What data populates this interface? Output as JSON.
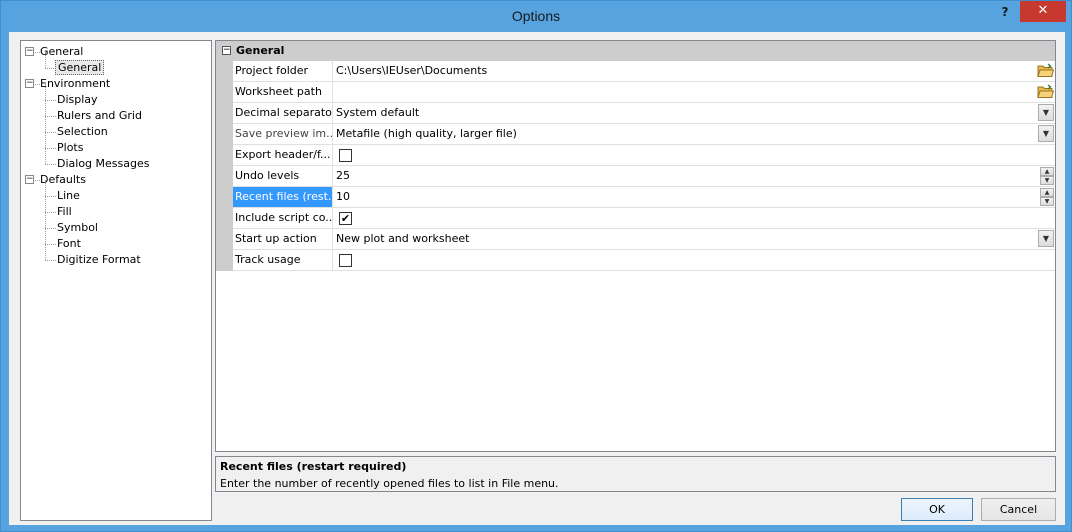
{
  "window": {
    "title": "Options",
    "help_label": "?",
    "close_label": "✕"
  },
  "tree": {
    "nodes": [
      {
        "label": "General",
        "level": 0,
        "expander": "−"
      },
      {
        "label": "General",
        "level": 1,
        "selected": true
      },
      {
        "label": "Environment",
        "level": 0,
        "expander": "−"
      },
      {
        "label": "Display",
        "level": 1
      },
      {
        "label": "Rulers and Grid",
        "level": 1
      },
      {
        "label": "Selection",
        "level": 1
      },
      {
        "label": "Plots",
        "level": 1
      },
      {
        "label": "Dialog Messages",
        "level": 1
      },
      {
        "label": "Defaults",
        "level": 0,
        "expander": "−"
      },
      {
        "label": "Line",
        "level": 1
      },
      {
        "label": "Fill",
        "level": 1
      },
      {
        "label": "Symbol",
        "level": 1
      },
      {
        "label": "Font",
        "level": 1
      },
      {
        "label": "Digitize Format",
        "level": 1
      }
    ]
  },
  "grid": {
    "category": {
      "label": "General",
      "expander": "−"
    },
    "rows": [
      {
        "name": "Project folder",
        "value": "C:\\Users\\IEUser\\Documents",
        "editor": "folder"
      },
      {
        "name": "Worksheet path",
        "value": "",
        "editor": "folder"
      },
      {
        "name": "Decimal separator",
        "value": "System default",
        "editor": "combo"
      },
      {
        "name": "Save preview im...",
        "value": "Metafile (high quality, larger file)",
        "editor": "combo"
      },
      {
        "name": "Export header/f...",
        "value": "",
        "editor": "check",
        "checked": false
      },
      {
        "name": "Undo levels",
        "value": "25",
        "editor": "spin"
      },
      {
        "name": "Recent files (rest...",
        "value": "10",
        "editor": "spin",
        "selected": true
      },
      {
        "name": "Include script co...",
        "value": "",
        "editor": "check",
        "checked": true
      },
      {
        "name": "Start up action",
        "value": "New plot and worksheet",
        "editor": "combo"
      },
      {
        "name": "Track usage",
        "value": "",
        "editor": "check",
        "checked": false
      }
    ]
  },
  "description": {
    "title": "Recent files (restart required)",
    "text": "Enter the number of recently opened files to list in File menu."
  },
  "buttons": {
    "ok": "OK",
    "cancel": "Cancel"
  },
  "colors": {
    "titlebar": "#56a3e0",
    "close": "#c7392e",
    "selection": "#3399ff",
    "category": "#cdcdcd"
  }
}
